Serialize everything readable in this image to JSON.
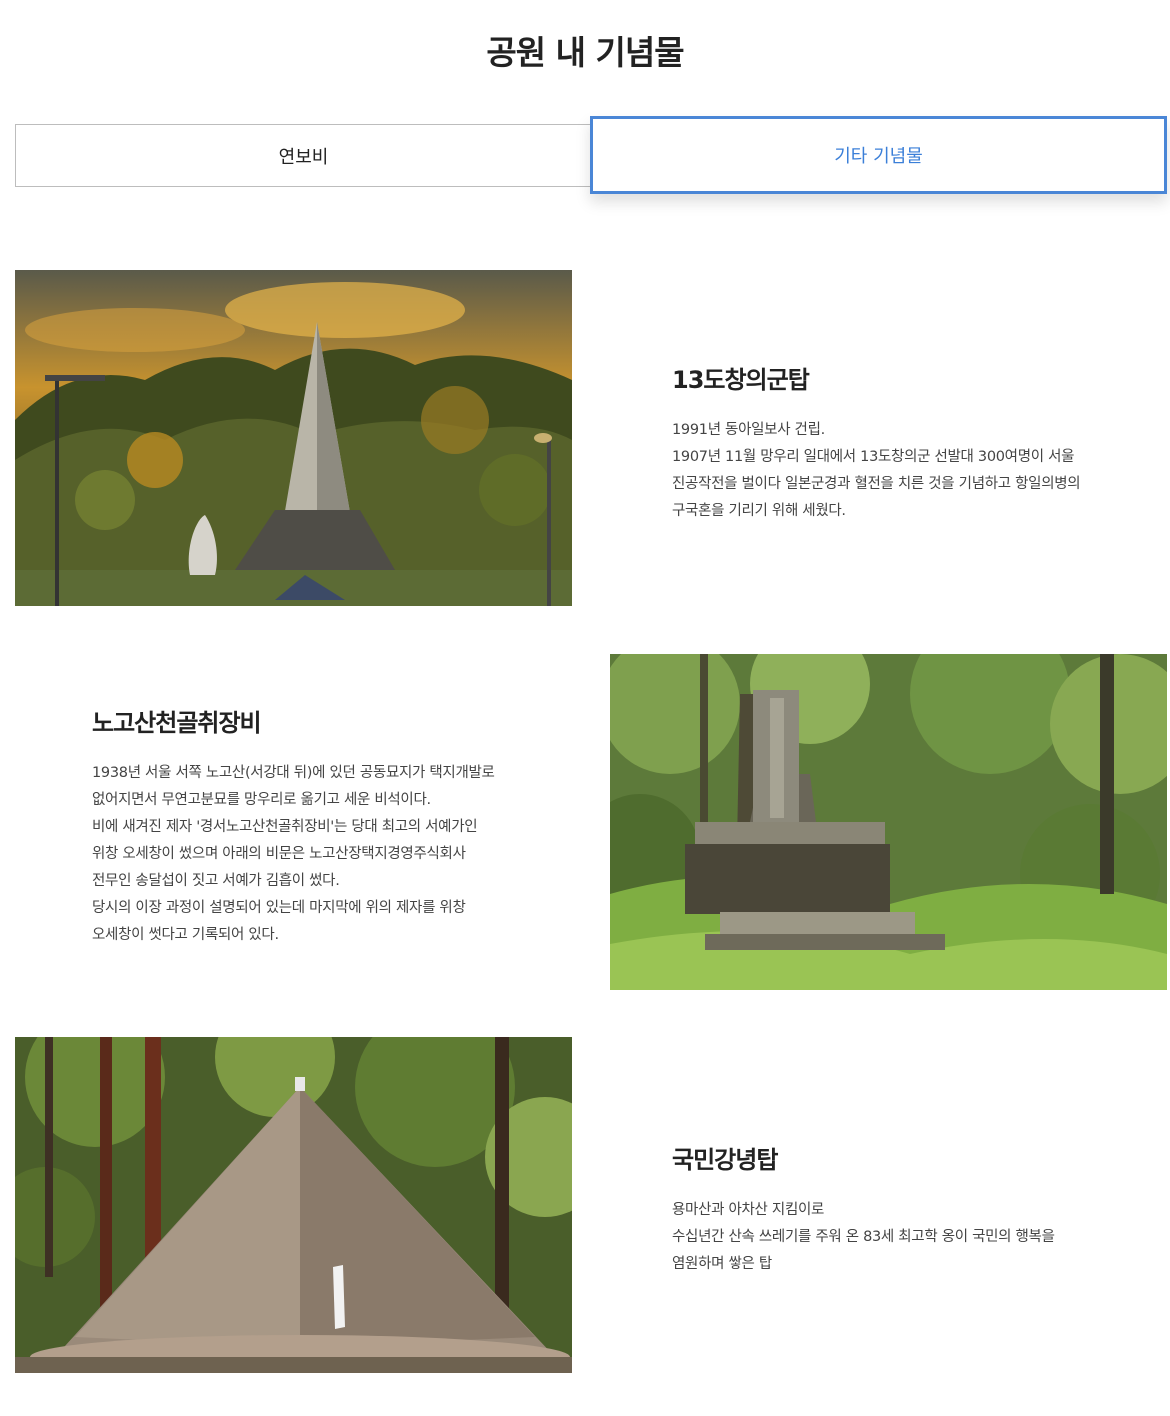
{
  "page": {
    "title": "공원 내 기념물"
  },
  "tabs": [
    {
      "label": "연보비",
      "active": false
    },
    {
      "label": "기타 기념물",
      "active": true
    }
  ],
  "colors": {
    "accent": "#4a86d6",
    "tab_border": "#bdbdbd",
    "text": "#222222",
    "body_text": "#444444"
  },
  "monuments": [
    {
      "title": "13도창의군탑",
      "lines": [
        "1991년 동아일보사 건립.",
        "1907년 11월 망우리 일대에서 13도창의군 선발대 300여명이 서울",
        "진공작전을 벌이다 일본군경과 혈전을 치른 것을 기념하고 항일의병의",
        "구국혼을 기리기 위해 세웠다."
      ]
    },
    {
      "title": "노고산천골취장비",
      "lines": [
        "1938년 서울 서쪽 노고산(서강대 뒤)에 있던 공동묘지가 택지개발로",
        "없어지면서 무연고분묘를 망우리로 옮기고 세운 비석이다.",
        "비에 새겨진 제자 '경서노고산천골취장비'는 당대 최고의 서예가인",
        "위창 오세창이 썼으며 아래의 비문은 노고산장택지경영주식회사",
        "전무인 송달섭이 짓고 서예가 김흡이 썼다.",
        "당시의 이장 과정이 설명되어 있는데 마지막에 위의 제자를 위창",
        "오세창이 썻다고 기록되어 있다."
      ]
    },
    {
      "title": "국민강녕탑",
      "lines": [
        "용마산과 아차산 지킴이로",
        "수십년간 산속 쓰레기를 주워 온 83세 최고학 옹이 국민의 행복을",
        "염원하며 쌓은 탑"
      ]
    }
  ]
}
